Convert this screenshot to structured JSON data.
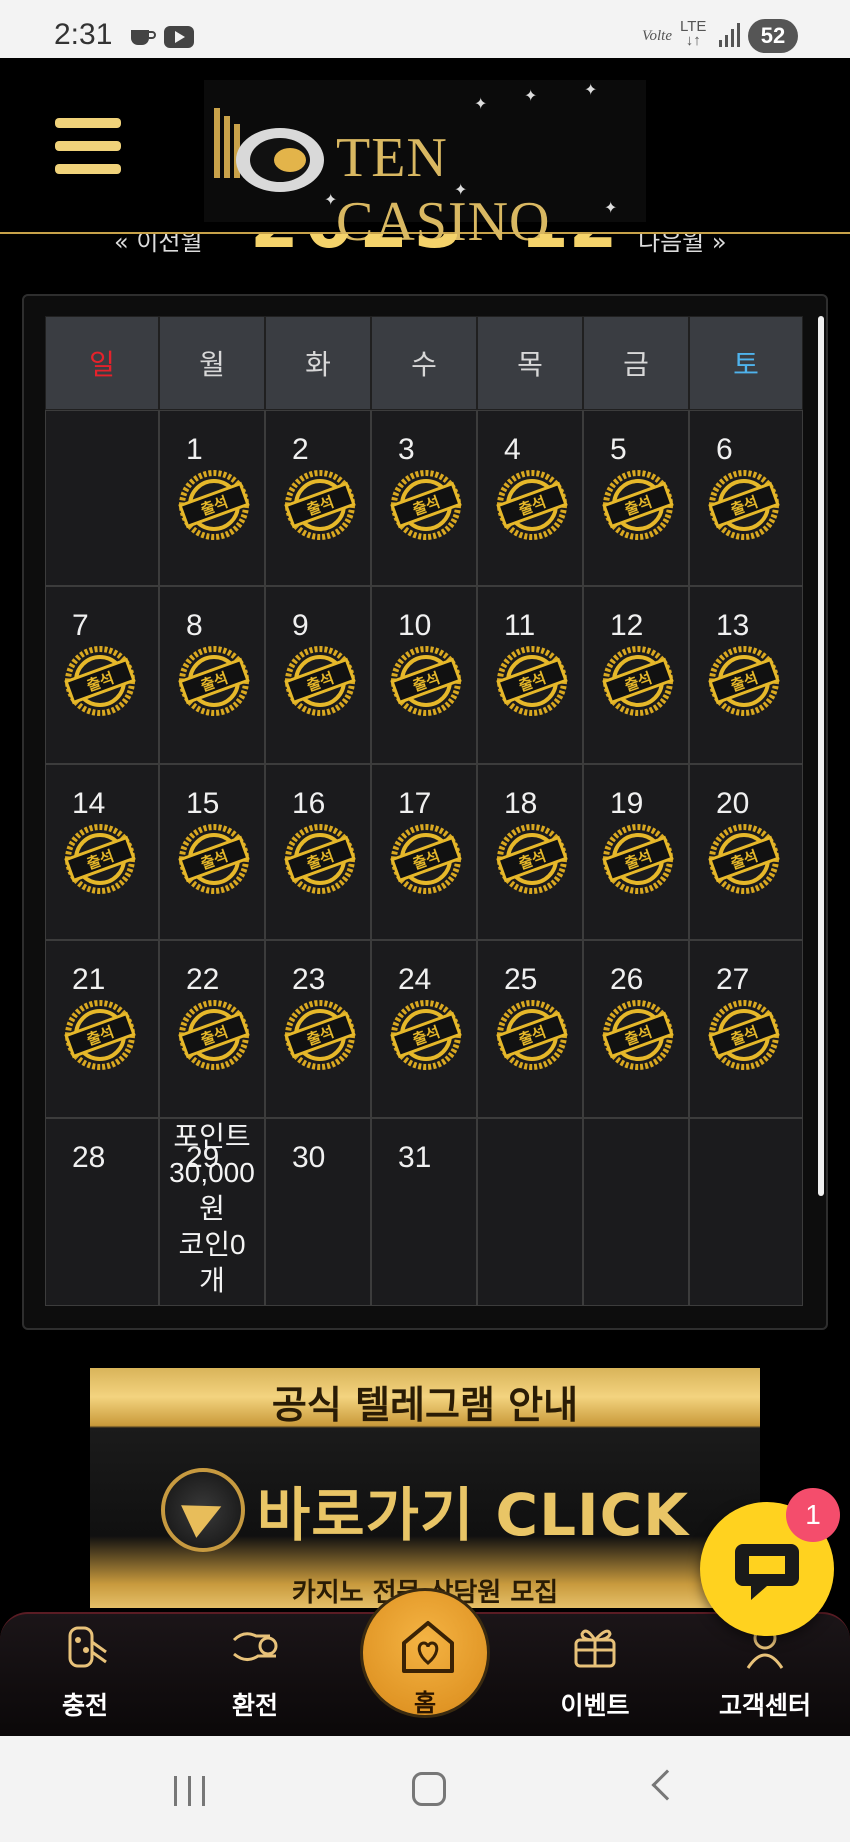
{
  "status_bar": {
    "time": "2:31",
    "volte": "Volte",
    "lte": "LTE",
    "battery": "52"
  },
  "header": {
    "logo_text": "TEN CASINO"
  },
  "month_nav": {
    "prev": "« 이전월",
    "year": "2023",
    "month": "12",
    "next": "다음월 »"
  },
  "calendar": {
    "weekdays": [
      {
        "label": "일",
        "color": "#e5222b"
      },
      {
        "label": "월",
        "color": "#d8d8d8"
      },
      {
        "label": "화",
        "color": "#d8d8d8"
      },
      {
        "label": "수",
        "color": "#d8d8d8"
      },
      {
        "label": "목",
        "color": "#d8d8d8"
      },
      {
        "label": "금",
        "color": "#d8d8d8"
      },
      {
        "label": "토",
        "color": "#4fb3ec"
      }
    ],
    "weeks": [
      [
        null,
        {
          "day": "1",
          "stamp": true
        },
        {
          "day": "2",
          "stamp": true
        },
        {
          "day": "3",
          "stamp": true
        },
        {
          "day": "4",
          "stamp": true
        },
        {
          "day": "5",
          "stamp": true
        },
        {
          "day": "6",
          "stamp": true
        }
      ],
      [
        {
          "day": "7",
          "stamp": true
        },
        {
          "day": "8",
          "stamp": true
        },
        {
          "day": "9",
          "stamp": true
        },
        {
          "day": "10",
          "stamp": true
        },
        {
          "day": "11",
          "stamp": true
        },
        {
          "day": "12",
          "stamp": true
        },
        {
          "day": "13",
          "stamp": true
        }
      ],
      [
        {
          "day": "14",
          "stamp": true
        },
        {
          "day": "15",
          "stamp": true
        },
        {
          "day": "16",
          "stamp": true
        },
        {
          "day": "17",
          "stamp": true
        },
        {
          "day": "18",
          "stamp": true
        },
        {
          "day": "19",
          "stamp": true
        },
        {
          "day": "20",
          "stamp": true
        }
      ],
      [
        {
          "day": "21",
          "stamp": true
        },
        {
          "day": "22",
          "stamp": true
        },
        {
          "day": "23",
          "stamp": true
        },
        {
          "day": "24",
          "stamp": true
        },
        {
          "day": "25",
          "stamp": true
        },
        {
          "day": "26",
          "stamp": true
        },
        {
          "day": "27",
          "stamp": true
        }
      ],
      [
        {
          "day": "28",
          "stamp": false
        },
        {
          "day": "29",
          "stamp": false,
          "today": true,
          "info": [
            "포인트",
            "30,000",
            "원",
            "코인0",
            "개"
          ]
        },
        {
          "day": "30",
          "stamp": false
        },
        {
          "day": "31",
          "stamp": false
        },
        null,
        null,
        null
      ]
    ],
    "stamp_label": "출석"
  },
  "banner": {
    "top_text": "공식 텔레그램 안내",
    "cta": "바로가기 CLICK",
    "bottom_text": "카지노 전문 상담원 모집"
  },
  "chat": {
    "badge": "1"
  },
  "bottom_nav": {
    "items": [
      {
        "label": "충전",
        "icon": "charge-icon"
      },
      {
        "label": "환전",
        "icon": "exchange-icon"
      },
      {
        "label": "홈",
        "icon": "home-heart-icon"
      },
      {
        "label": "이벤트",
        "icon": "gift-icon"
      },
      {
        "label": "고객센터",
        "icon": "support-icon"
      }
    ]
  },
  "colors": {
    "accent_gold": "#f5d36b",
    "sunday": "#e5222b",
    "saturday": "#4fb3ec",
    "chat_yellow": "#ffd21f",
    "badge_pink": "#f44d6c"
  }
}
